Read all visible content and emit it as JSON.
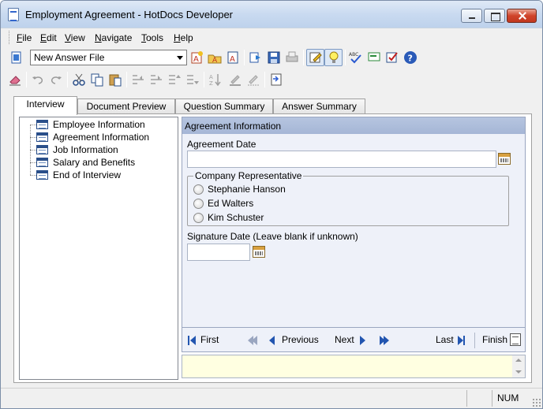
{
  "window": {
    "title": "Employment Agreement - HotDocs Developer"
  },
  "menu": {
    "items": [
      "File",
      "Edit",
      "View",
      "Navigate",
      "Tools",
      "Help"
    ]
  },
  "toolbar": {
    "answer_file_value": "New Answer File",
    "icons_row1": [
      "answer-source-icon",
      "new-answer-file-icon",
      "open-answer-file-icon",
      "edit-answer-file-icon",
      "forward-icon",
      "save-icon",
      "print-icon",
      "edit-component-icon",
      "tips-bulb-icon",
      "spell-check-icon",
      "comment-icon",
      "check-answers-icon",
      "help-icon"
    ],
    "icons_row2": [
      "eraser-icon",
      "undo-icon",
      "redo-icon",
      "cut-icon",
      "copy-icon",
      "paste-icon",
      "outdent-icon",
      "indent-icon",
      "move-up-icon",
      "move-down-icon",
      "sort-icon",
      "highlight-icon",
      "clear-format-icon",
      "insert-icon"
    ]
  },
  "tabs": [
    {
      "label": "Interview",
      "active": true
    },
    {
      "label": "Document Preview",
      "active": false
    },
    {
      "label": "Question Summary",
      "active": false
    },
    {
      "label": "Answer Summary",
      "active": false
    }
  ],
  "outline": {
    "items": [
      {
        "label": "Employee Information"
      },
      {
        "label": "Agreement Information"
      },
      {
        "label": "Job Information"
      },
      {
        "label": "Salary and Benefits"
      },
      {
        "label": "End of Interview"
      }
    ]
  },
  "dialog": {
    "title": "Agreement Information",
    "agreement_date_label": "Agreement Date",
    "agreement_date_value": "",
    "rep_group_label": "Company Representative",
    "rep_options": [
      "Stephanie Hanson",
      "Ed Walters",
      "Kim Schuster"
    ],
    "signature_date_label": "Signature Date (Leave blank if unknown)",
    "signature_date_value": ""
  },
  "nav": {
    "first": "First",
    "previous": "Previous",
    "next": "Next",
    "last": "Last",
    "finish": "Finish"
  },
  "status": {
    "num": "NUM"
  }
}
